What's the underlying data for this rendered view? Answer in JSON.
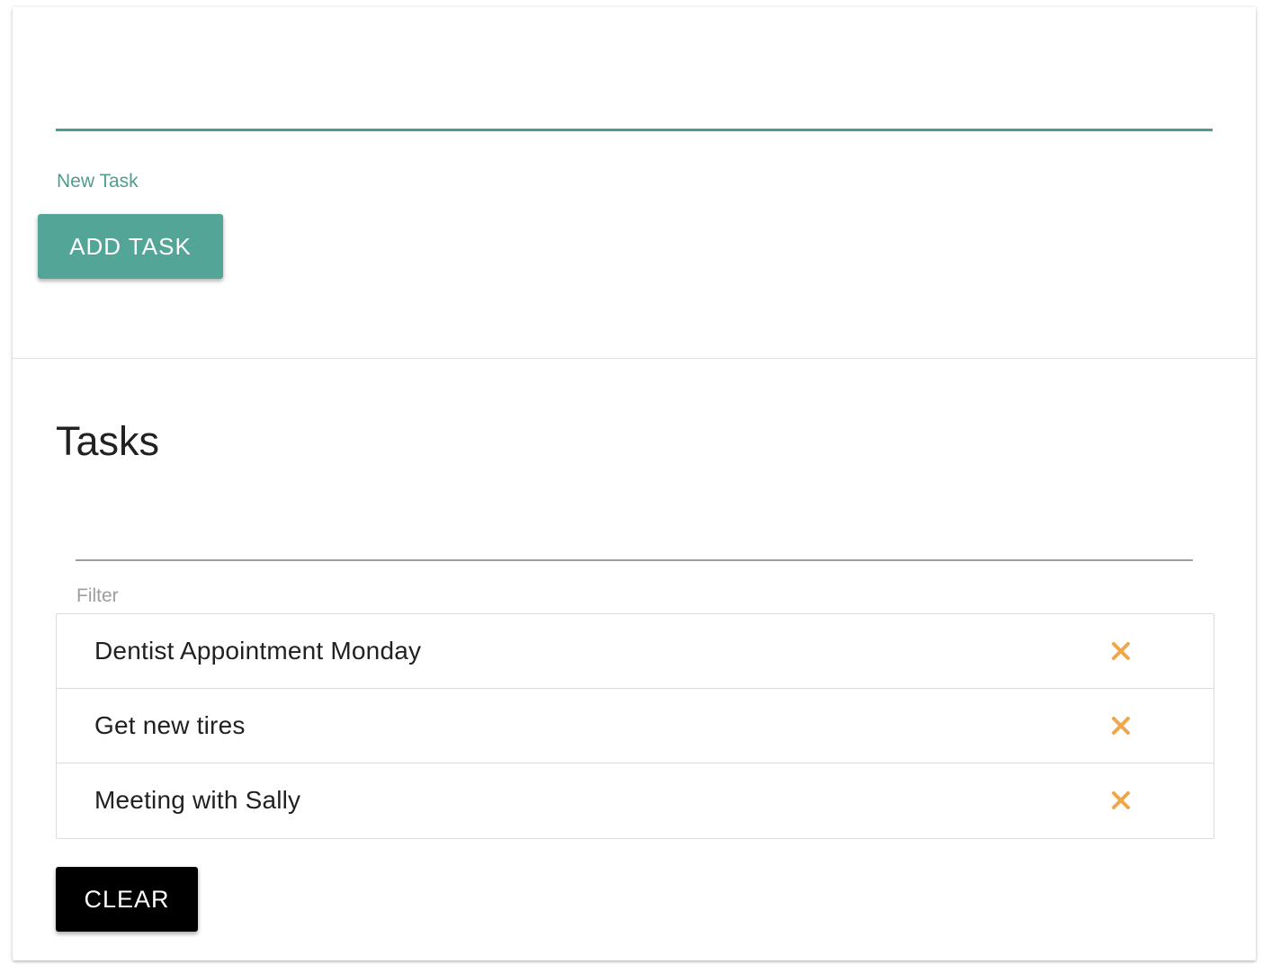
{
  "new_task": {
    "value": "",
    "label": "New Task",
    "accent_color": "#4f9d8f"
  },
  "add_button": {
    "label": "ADD TASK",
    "color": "#52a597"
  },
  "tasks_section": {
    "title": "Tasks",
    "filter": {
      "value": "",
      "label": "Filter"
    },
    "items": [
      {
        "text": "Dentist Appointment Monday",
        "delete_icon": "close-icon"
      },
      {
        "text": "Get new tires",
        "delete_icon": "close-icon"
      },
      {
        "text": "Meeting with Sally",
        "delete_icon": "close-icon"
      }
    ],
    "delete_icon_color": "#f0a64a"
  },
  "clear_button": {
    "label": "CLEAR",
    "color": "#000000"
  }
}
